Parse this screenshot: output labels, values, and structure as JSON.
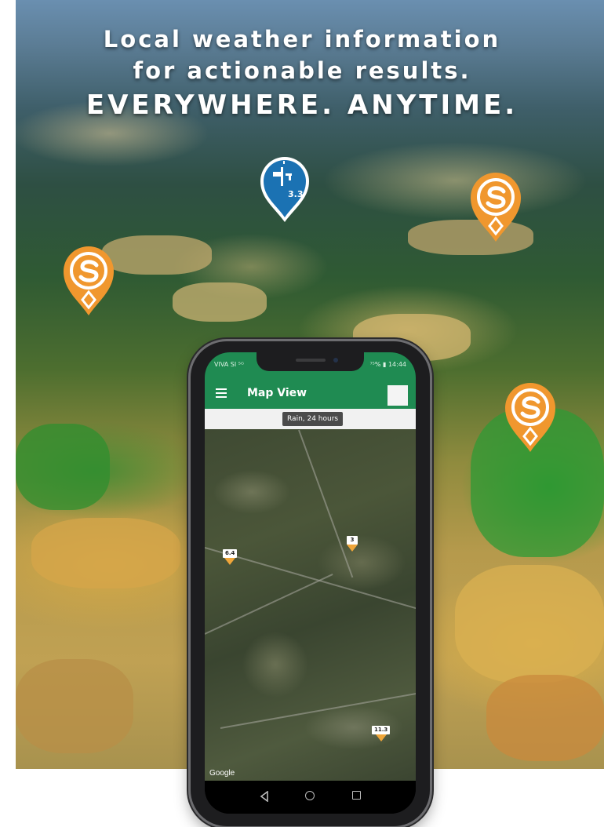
{
  "headline": {
    "line1": "Local weather information",
    "line2": "for actionable results.",
    "line3": "EVERYWHERE. ANYTIME."
  },
  "station_pin": {
    "icon": "weather-station-icon",
    "value": "3.3",
    "color": "#1b72b3"
  },
  "sensor_pins": {
    "icon": "sensor-s-icon",
    "color": "#f0972e"
  },
  "phone": {
    "status_left": "VIVA SI ⁵ᴳ",
    "status_right": "⁷⁵% ▮ 14:44",
    "app_title": "Map View",
    "filter_chip": "Rain, 24 hours",
    "map_markers": [
      {
        "value": "6.4"
      },
      {
        "value": "3"
      },
      {
        "value": "11.3"
      }
    ],
    "map_attribution": "Google",
    "accent": "#1f8b52"
  }
}
